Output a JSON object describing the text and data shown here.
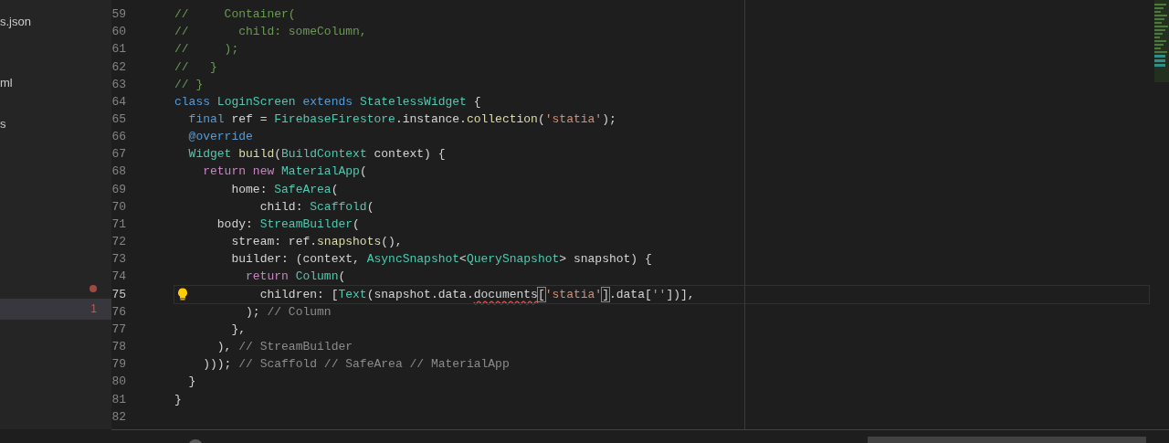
{
  "sidebar": {
    "items": [
      {
        "label": "s.json",
        "selected": false
      },
      {
        "label": "ml",
        "selected": false
      },
      {
        "label": "s",
        "selected": false
      },
      {
        "problem_dot": true,
        "selected": false
      },
      {
        "badge": "1",
        "selected": true
      }
    ]
  },
  "editor": {
    "lines": [
      {
        "number": "59",
        "current": false,
        "tokens": [
          {
            "text": "//     Container(",
            "kind": "comment"
          }
        ]
      },
      {
        "number": "60",
        "current": false,
        "tokens": [
          {
            "text": "//       child: someColumn,",
            "kind": "comment"
          }
        ]
      },
      {
        "number": "61",
        "current": false,
        "tokens": [
          {
            "text": "//     );",
            "kind": "comment"
          }
        ]
      },
      {
        "number": "62",
        "current": false,
        "tokens": [
          {
            "text": "//   }",
            "kind": "comment"
          }
        ]
      },
      {
        "number": "63",
        "current": false,
        "tokens": [
          {
            "text": "// }",
            "kind": "comment"
          }
        ]
      },
      {
        "number": "64",
        "current": false,
        "tokens": [
          {
            "text": "class ",
            "kind": "keyword"
          },
          {
            "text": "LoginScreen ",
            "kind": "type"
          },
          {
            "text": "extends ",
            "kind": "keyword"
          },
          {
            "text": "StatelessWidget",
            "kind": "type"
          },
          {
            "text": " {",
            "kind": "plain"
          }
        ]
      },
      {
        "number": "65",
        "current": false,
        "tokens": [
          {
            "text": "  final",
            "kind": "keyword"
          },
          {
            "text": " ref = ",
            "kind": "plain"
          },
          {
            "text": "FirebaseFirestore",
            "kind": "type"
          },
          {
            "text": ".instance.",
            "kind": "plain"
          },
          {
            "text": "collection",
            "kind": "function"
          },
          {
            "text": "(",
            "kind": "plain"
          },
          {
            "text": "'statia'",
            "kind": "string"
          },
          {
            "text": ");",
            "kind": "plain"
          }
        ]
      },
      {
        "number": "66",
        "current": false,
        "tokens": [
          {
            "text": "  @override",
            "kind": "keyword"
          }
        ]
      },
      {
        "number": "67",
        "current": false,
        "tokens": [
          {
            "text": "  Widget ",
            "kind": "type"
          },
          {
            "text": "build",
            "kind": "function"
          },
          {
            "text": "(",
            "kind": "plain"
          },
          {
            "text": "BuildContext",
            "kind": "type"
          },
          {
            "text": " context) {",
            "kind": "plain"
          }
        ]
      },
      {
        "number": "68",
        "current": false,
        "tokens": [
          {
            "text": "    return new ",
            "kind": "control"
          },
          {
            "text": "MaterialApp",
            "kind": "type"
          },
          {
            "text": "(",
            "kind": "plain"
          }
        ]
      },
      {
        "number": "69",
        "current": false,
        "tokens": [
          {
            "text": "        home: ",
            "kind": "plain"
          },
          {
            "text": "SafeArea",
            "kind": "type"
          },
          {
            "text": "(",
            "kind": "plain"
          }
        ]
      },
      {
        "number": "70",
        "current": false,
        "tokens": [
          {
            "text": "            child: ",
            "kind": "plain"
          },
          {
            "text": "Scaffold",
            "kind": "type"
          },
          {
            "text": "(",
            "kind": "plain"
          }
        ]
      },
      {
        "number": "71",
        "current": false,
        "tokens": [
          {
            "text": "      body: ",
            "kind": "plain"
          },
          {
            "text": "StreamBuilder",
            "kind": "type"
          },
          {
            "text": "(",
            "kind": "plain"
          }
        ]
      },
      {
        "number": "72",
        "current": false,
        "tokens": [
          {
            "text": "        stream: ref.",
            "kind": "plain"
          },
          {
            "text": "snapshots",
            "kind": "function"
          },
          {
            "text": "(),",
            "kind": "plain"
          }
        ]
      },
      {
        "number": "73",
        "current": false,
        "tokens": [
          {
            "text": "        builder: (context, ",
            "kind": "plain"
          },
          {
            "text": "AsyncSnapshot",
            "kind": "type"
          },
          {
            "text": "<",
            "kind": "plain"
          },
          {
            "text": "QuerySnapshot",
            "kind": "type"
          },
          {
            "text": "> snapshot) {",
            "kind": "plain"
          }
        ]
      },
      {
        "number": "74",
        "current": false,
        "tokens": [
          {
            "text": "          return ",
            "kind": "control"
          },
          {
            "text": "Column",
            "kind": "type"
          },
          {
            "text": "(",
            "kind": "plain"
          }
        ]
      },
      {
        "number": "75",
        "current": true,
        "lightbulb": true,
        "tokens": [
          {
            "text": "            children: [",
            "kind": "plain"
          },
          {
            "text": "Text",
            "kind": "type"
          },
          {
            "text": "(snapshot.data.",
            "kind": "plain"
          },
          {
            "text": "documents",
            "kind": "error"
          },
          {
            "text": "[",
            "kind": "bracket-match"
          },
          {
            "text": "'statia'",
            "kind": "string"
          },
          {
            "text": "]",
            "kind": "bracket-match"
          },
          {
            "text": ".data[",
            "kind": "plain"
          },
          {
            "text": "''",
            "kind": "string"
          },
          {
            "text": "])],",
            "kind": "plain"
          }
        ]
      },
      {
        "number": "76",
        "current": false,
        "tokens": [
          {
            "text": "          ); ",
            "kind": "plain"
          },
          {
            "text": "// Column",
            "kind": "hint"
          }
        ]
      },
      {
        "number": "77",
        "current": false,
        "tokens": [
          {
            "text": "        },",
            "kind": "plain"
          }
        ]
      },
      {
        "number": "78",
        "current": false,
        "tokens": [
          {
            "text": "      ), ",
            "kind": "plain"
          },
          {
            "text": "// StreamBuilder",
            "kind": "hint"
          }
        ]
      },
      {
        "number": "79",
        "current": false,
        "tokens": [
          {
            "text": "    ))); ",
            "kind": "plain"
          },
          {
            "text": "// Scaffold // SafeArea // MaterialApp",
            "kind": "hint"
          }
        ]
      },
      {
        "number": "80",
        "current": false,
        "tokens": [
          {
            "text": "  }",
            "kind": "plain"
          }
        ]
      },
      {
        "number": "81",
        "current": false,
        "tokens": [
          {
            "text": "}",
            "kind": "plain"
          }
        ]
      },
      {
        "number": "82",
        "current": false
      }
    ]
  }
}
